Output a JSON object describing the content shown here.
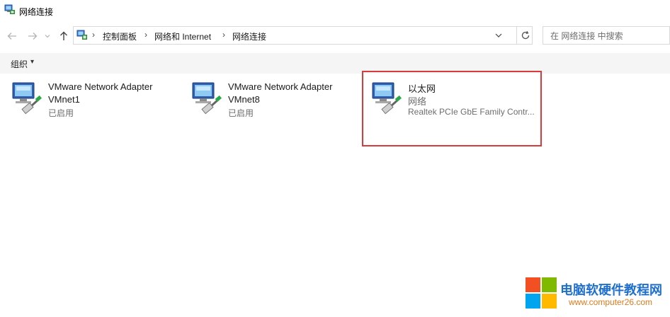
{
  "window": {
    "title": "网络连接",
    "title_icon": "network-connections-icon"
  },
  "nav": {
    "back_icon": "arrow-left-icon",
    "forward_icon": "arrow-right-icon",
    "recent_icon": "chevron-down-icon",
    "up_icon": "arrow-up-icon"
  },
  "address": {
    "crumbs": [
      "控制面板",
      "网络和 Internet",
      "网络连接"
    ],
    "separator": "›",
    "dropdown_icon": "chevron-down-icon",
    "refresh_icon": "refresh-icon"
  },
  "search": {
    "placeholder": "在 网络连接 中搜索"
  },
  "command_bar": {
    "organize_label": "组织",
    "organize_caret": "▾"
  },
  "connections": [
    {
      "name": "VMware Network Adapter",
      "line2": "VMnet1",
      "status": "已启用"
    },
    {
      "name": "VMware Network Adapter",
      "line2": "VMnet8",
      "status": "已启用"
    },
    {
      "name": "以太网",
      "line2": "网络",
      "status": "Realtek PCIe GbE Family Contr..."
    }
  ],
  "watermark": {
    "text": "电脑软硬件教程网",
    "url": "www.computer26.com"
  },
  "colors": {
    "highlight": "#d93a3a",
    "watermark_blue": "#1f6fcf",
    "watermark_orange": "#e07a1a"
  }
}
